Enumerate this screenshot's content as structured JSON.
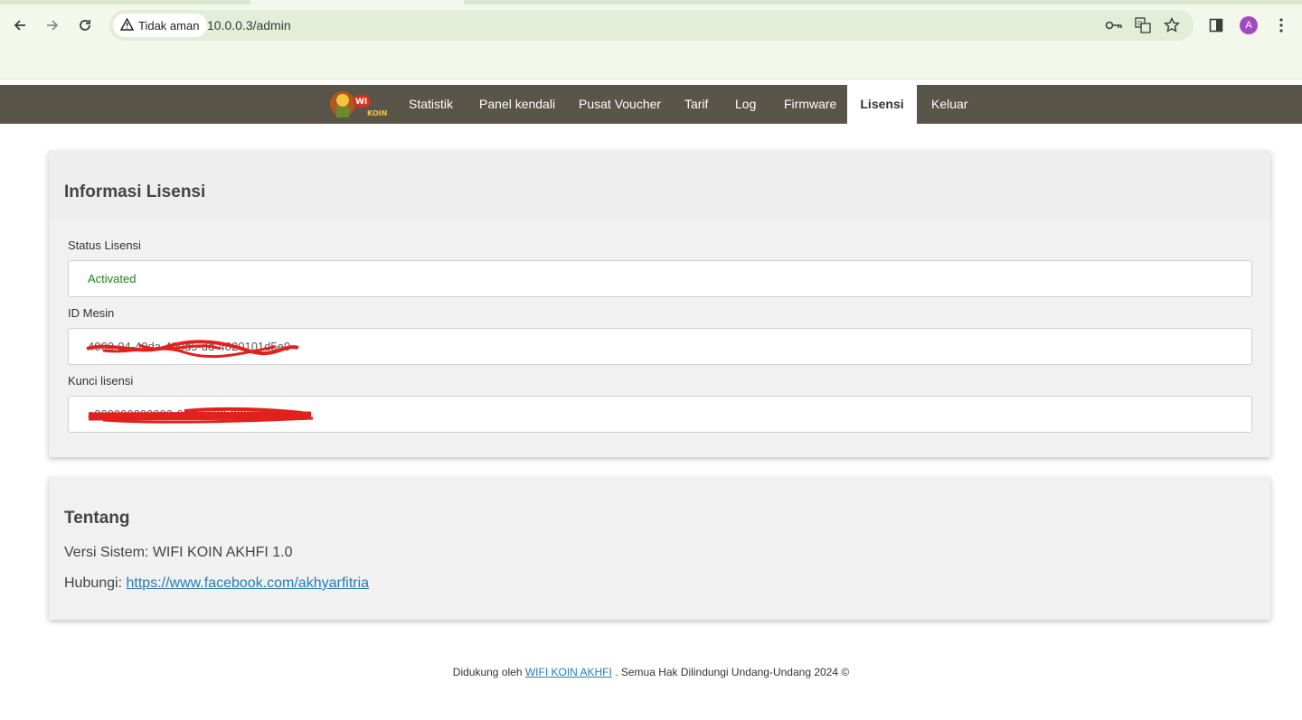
{
  "browser": {
    "security_label": "Tidak aman",
    "url": "10.0.0.3/admin",
    "profile_initial": "A",
    "icons": [
      "back-icon",
      "forward-icon",
      "reload-icon",
      "warning-icon",
      "key-icon",
      "translate-icon",
      "star-icon",
      "side-panel-icon",
      "menu-icon"
    ]
  },
  "nav": {
    "logo_text": "WIFI KOIN",
    "items": [
      {
        "label": "Statistik"
      },
      {
        "label": "Panel kendali"
      },
      {
        "label": "Pusat Voucher"
      },
      {
        "label": "Tarif"
      },
      {
        "label": "Log"
      },
      {
        "label": "Firmware"
      },
      {
        "label": "Lisensi"
      },
      {
        "label": "Keluar"
      }
    ],
    "active": "Lisensi"
  },
  "license": {
    "title": "Informasi Lisensi",
    "status_label": "Status Lisensi",
    "status_value": "Activated",
    "status_color": "#1e7d22",
    "machine_id_label": "ID Mesin",
    "machine_id_value": "4000-04-40da-400d5-dd-4020101d5e0",
    "license_key_label": "Kunci lisensi",
    "license_key_value": "a000000000000-000-0000-000000000",
    "redaction_color": "#e0211d"
  },
  "about": {
    "title": "Tentang",
    "version_prefix": "Versi Sistem: ",
    "version": "WIFI KOIN AKHFI 1.0",
    "contact_prefix": "Hubungi: ",
    "contact_link": "https://www.facebook.com/akhyarfitria"
  },
  "footer": {
    "prefix": "Didukung oleh ",
    "link": "WIFI KOIN AKHFI",
    "suffix": " . Semua Hak Dilindungi Undang-Undang 2024 ©"
  }
}
